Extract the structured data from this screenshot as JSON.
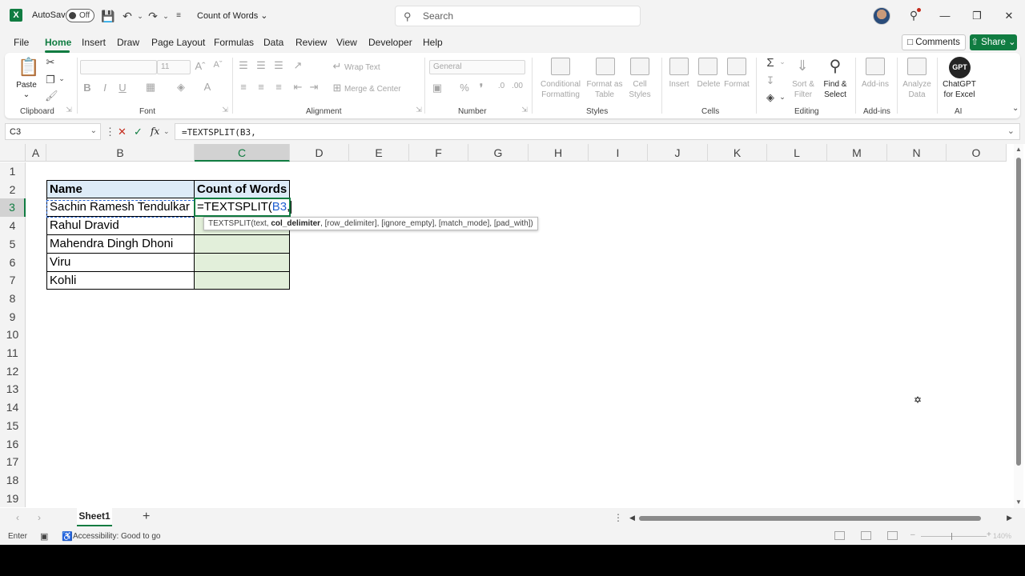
{
  "titlebar": {
    "autosave_label": "AutoSave",
    "autosave_state": "Off",
    "document_title": "Count of Words",
    "search_placeholder": "Search"
  },
  "menu": {
    "items": [
      "File",
      "Home",
      "Insert",
      "Draw",
      "Page Layout",
      "Formulas",
      "Data",
      "Review",
      "View",
      "Developer",
      "Help"
    ],
    "active": "Home",
    "comments_label": "Comments",
    "share_label": "Share"
  },
  "ribbon": {
    "clipboard": {
      "paste": "Paste",
      "label": "Clipboard"
    },
    "font": {
      "font_name": "",
      "font_size": "11",
      "label": "Font"
    },
    "alignment": {
      "wrap_text": "Wrap Text",
      "merge_center": "Merge & Center",
      "label": "Alignment"
    },
    "number": {
      "format": "General",
      "label": "Number"
    },
    "styles": {
      "conditional": "Conditional\nFormatting",
      "format_table": "Format as\nTable",
      "cell_styles": "Cell\nStyles",
      "label": "Styles"
    },
    "cells": {
      "insert": "Insert",
      "delete": "Delete",
      "format": "Format",
      "label": "Cells"
    },
    "editing": {
      "sort_filter": "Sort &\nFilter",
      "find_select": "Find &\nSelect",
      "label": "Editing"
    },
    "addins": {
      "addins": "Add-ins",
      "label": "Add-ins"
    },
    "analyze": {
      "analyze_data": "Analyze\nData"
    },
    "ai": {
      "gpt_badge": "GPT",
      "chatgpt": "ChatGPT\nfor Excel",
      "label": "AI"
    }
  },
  "formula_bar": {
    "name_box": "C3",
    "fx": "fx",
    "formula": "=TEXTSPLIT(B3,"
  },
  "grid": {
    "columns": [
      "A",
      "B",
      "C",
      "D",
      "E",
      "F",
      "G",
      "H",
      "I",
      "J",
      "K",
      "L",
      "M",
      "N",
      "O"
    ],
    "rows": [
      "1",
      "2",
      "3",
      "4",
      "5",
      "6",
      "7",
      "8",
      "9",
      "10",
      "11",
      "12",
      "13",
      "14",
      "15",
      "16",
      "17",
      "18",
      "19"
    ],
    "selected_column": "C",
    "selected_row": "3",
    "table_header": {
      "name": "Name",
      "count": "Count of Words"
    },
    "names": [
      "Sachin Ramesh Tendulkar",
      "Rahul Dravid",
      "Mahendra Dingh Dhoni",
      "Viru",
      "Kohli"
    ],
    "editing_cell": {
      "prefix": "=TEXTSPLIT(",
      "ref": "B3",
      "suffix": ","
    },
    "tooltip": {
      "func": "TEXTSPLIT(text, ",
      "bold": "col_delimiter",
      "rest": ", [row_delimiter], [ignore_empty], [match_mode], [pad_with])"
    }
  },
  "sheets": {
    "tabs": [
      "Sheet1"
    ],
    "active": "Sheet1"
  },
  "statusbar": {
    "mode": "Enter",
    "accessibility": "Accessibility: Good to go",
    "zoom": "140%"
  },
  "colors": {
    "accent": "#107c41",
    "header_fill": "#ddebf7",
    "count_fill": "#e2efda",
    "reference": "#1f5fd1"
  }
}
